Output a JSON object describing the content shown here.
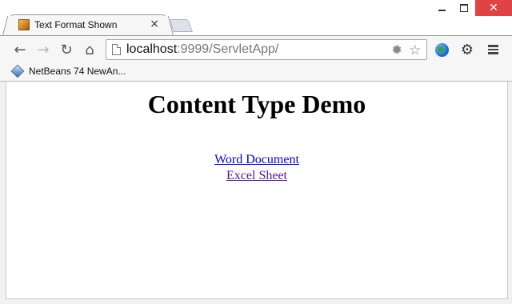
{
  "tab": {
    "title": "Text Format Shown",
    "close_glyph": "×",
    "favicon": "servlet-favicon"
  },
  "window_controls": {
    "close_glyph": "✕"
  },
  "toolbar": {
    "back_glyph": "←",
    "forward_glyph": "→",
    "reload_glyph": "↻",
    "home_glyph": "⌂",
    "url_host": "localhost",
    "url_rest": ":9999/ServletApp/",
    "extension_glyph": "✹",
    "star_glyph": "☆",
    "settings_glyph": "⚙"
  },
  "bookmarks": {
    "items": [
      {
        "label": "NetBeans 74 NewAn..."
      }
    ]
  },
  "page": {
    "heading": "Content Type Demo",
    "links": [
      {
        "label": "Word Document",
        "state": "unvisited",
        "color": "#0000ee"
      },
      {
        "label": "Excel Sheet",
        "state": "visited",
        "color": "#551a8b"
      }
    ]
  },
  "colors": {
    "close_button": "#e04343",
    "link": "#0000ee",
    "visited_link": "#551a8b"
  }
}
